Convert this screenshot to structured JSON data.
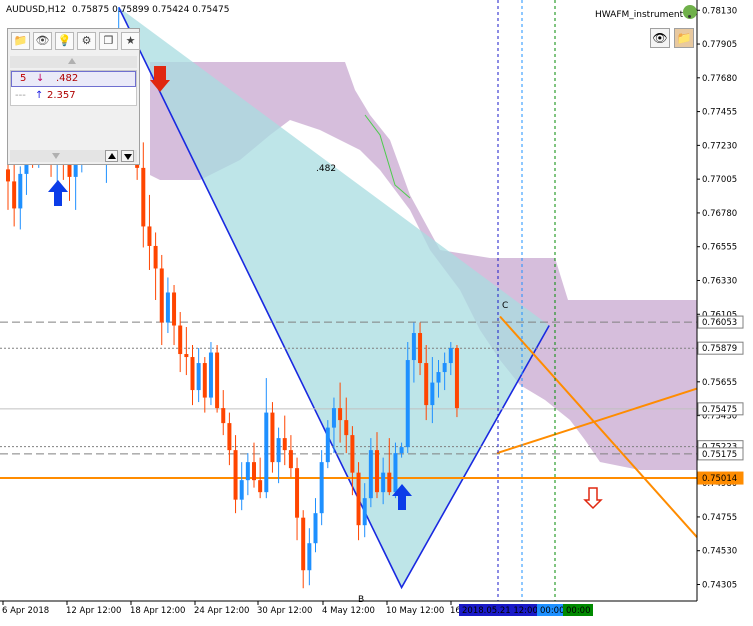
{
  "window": {
    "symbol_label": "AUDUSD,H12",
    "ohlc_label": "0.75875 0.75899 0.75424 0.75475"
  },
  "indicator": {
    "name": "HWAFM_instrument",
    "icon_name": "weather-icon"
  },
  "info_panel": {
    "toolbar_icons": [
      "folder-icon",
      "eye-icon",
      "bulb-icon",
      "gear-icon",
      "copy-icon",
      "star-icon"
    ],
    "zigzag_rows": [
      {
        "count": "5",
        "arrow": "↓",
        "value": ".482"
      },
      {
        "count": "---",
        "arrow": "↑",
        "value": "2.357"
      }
    ]
  },
  "price_axis": {
    "labels": [
      "0.78130",
      "0.77905",
      "0.77680",
      "0.77455",
      "0.77230",
      "0.77005",
      "0.76780",
      "0.76555",
      "0.76330",
      "0.76105",
      "0.75880",
      "0.75655",
      "0.75430",
      "0.75205",
      "0.74980",
      "0.74755",
      "0.74530",
      "0.74305"
    ],
    "highlights": [
      {
        "price": 0.76053,
        "text": "0.76053",
        "style": "gray"
      },
      {
        "price": 0.75879,
        "text": "0.75879",
        "style": "gray"
      },
      {
        "price": 0.75475,
        "text": "0.75475",
        "style": "gray"
      },
      {
        "price": 0.75223,
        "text": "0.75223",
        "style": "gray"
      },
      {
        "price": 0.75175,
        "text": "0.75175",
        "style": "gray"
      },
      {
        "price": 0.75014,
        "text": "0.75014",
        "style": "orange"
      }
    ]
  },
  "time_axis": {
    "labels": [
      "6 Apr 2018",
      "12 Apr 12:00",
      "18 Apr 12:00",
      "24 Apr 12:00",
      "30 Apr 12:00",
      "4 May 12:00",
      "10 May 12:00",
      "16"
    ],
    "highlight_labels": [
      {
        "text": "2018.05.21 12:00",
        "color": "#1a1ac8"
      },
      {
        "text": "00:00",
        "color": "#1e90ff"
      },
      {
        "text": "00:00",
        "color": "#008a00"
      }
    ]
  },
  "annotations": {
    "pattern_label": ".482",
    "point_b": "B",
    "point_c": "C"
  },
  "colors": {
    "bull": "#1e90ff",
    "bear": "#ff4500",
    "cloud": "#c8a8d0",
    "pattern_fill": "#a8dce0",
    "pattern_line": "#1a2ae0",
    "orange_line": "#ff8c00",
    "arrow_blue": "#0b3ce8",
    "arrow_red": "#e02810"
  },
  "chart_data": {
    "type": "candlestick",
    "title": "AUDUSD,H12",
    "ylim": [
      0.74195,
      0.78185
    ],
    "candles": [
      [
        0.7707,
        0.7723,
        0.768,
        0.7699
      ],
      [
        0.7699,
        0.7716,
        0.7669,
        0.7681
      ],
      [
        0.7681,
        0.7709,
        0.7667,
        0.7704
      ],
      [
        0.7704,
        0.7739,
        0.769,
        0.7727
      ],
      [
        0.7727,
        0.7764,
        0.7708,
        0.7715
      ],
      [
        0.7715,
        0.7736,
        0.7708,
        0.773
      ],
      [
        0.773,
        0.7757,
        0.7722,
        0.7745
      ],
      [
        0.7745,
        0.777,
        0.7702,
        0.7713
      ],
      [
        0.7713,
        0.7738,
        0.7696,
        0.7722
      ],
      [
        0.7722,
        0.774,
        0.77,
        0.7712
      ],
      [
        0.7712,
        0.7748,
        0.7686,
        0.7702
      ],
      [
        0.7702,
        0.773,
        0.768,
        0.7719
      ],
      [
        0.7719,
        0.7745,
        0.7705,
        0.7736
      ],
      [
        0.7736,
        0.776,
        0.772,
        0.7748
      ],
      [
        0.7748,
        0.7765,
        0.7729,
        0.7742
      ],
      [
        0.7742,
        0.775,
        0.771,
        0.7722
      ],
      [
        0.7722,
        0.776,
        0.7698,
        0.775
      ],
      [
        0.775,
        0.7778,
        0.773,
        0.7768
      ],
      [
        0.7768,
        0.7815,
        0.774,
        0.7775
      ],
      [
        0.7775,
        0.7782,
        0.773,
        0.7738
      ],
      [
        0.7738,
        0.7752,
        0.7715,
        0.7728
      ],
      [
        0.7728,
        0.7745,
        0.77,
        0.7708
      ],
      [
        0.7708,
        0.7725,
        0.7655,
        0.7669
      ],
      [
        0.7669,
        0.769,
        0.764,
        0.7656
      ],
      [
        0.7656,
        0.7665,
        0.762,
        0.7641
      ],
      [
        0.7641,
        0.765,
        0.759,
        0.7605
      ],
      [
        0.7605,
        0.7635,
        0.7598,
        0.7625
      ],
      [
        0.7625,
        0.763,
        0.759,
        0.7603
      ],
      [
        0.7603,
        0.7612,
        0.7572,
        0.7584
      ],
      [
        0.7584,
        0.7602,
        0.757,
        0.7582
      ],
      [
        0.7582,
        0.759,
        0.755,
        0.756
      ],
      [
        0.756,
        0.7588,
        0.7552,
        0.7578
      ],
      [
        0.7578,
        0.7582,
        0.7545,
        0.7555
      ],
      [
        0.7555,
        0.7592,
        0.755,
        0.7585
      ],
      [
        0.7585,
        0.759,
        0.7545,
        0.7548
      ],
      [
        0.7548,
        0.756,
        0.753,
        0.7538
      ],
      [
        0.7538,
        0.7545,
        0.751,
        0.752
      ],
      [
        0.752,
        0.753,
        0.7478,
        0.7487
      ],
      [
        0.7487,
        0.7512,
        0.748,
        0.75
      ],
      [
        0.75,
        0.7518,
        0.749,
        0.7512
      ],
      [
        0.7512,
        0.7525,
        0.7495,
        0.75
      ],
      [
        0.75,
        0.7515,
        0.7488,
        0.7492
      ],
      [
        0.7492,
        0.7568,
        0.7488,
        0.7545
      ],
      [
        0.7545,
        0.7552,
        0.7505,
        0.7512
      ],
      [
        0.7512,
        0.7535,
        0.7498,
        0.7528
      ],
      [
        0.7528,
        0.7543,
        0.751,
        0.752
      ],
      [
        0.752,
        0.753,
        0.7502,
        0.7508
      ],
      [
        0.7508,
        0.7515,
        0.746,
        0.7475
      ],
      [
        0.7475,
        0.748,
        0.7428,
        0.744
      ],
      [
        0.744,
        0.7468,
        0.743,
        0.7458
      ],
      [
        0.7458,
        0.7488,
        0.7452,
        0.7478
      ],
      [
        0.7478,
        0.752,
        0.747,
        0.7512
      ],
      [
        0.7512,
        0.754,
        0.7508,
        0.7535
      ],
      [
        0.7535,
        0.7555,
        0.7518,
        0.7548
      ],
      [
        0.7548,
        0.7565,
        0.7525,
        0.754
      ],
      [
        0.754,
        0.7555,
        0.7518,
        0.753
      ],
      [
        0.753,
        0.7536,
        0.749,
        0.7505
      ],
      [
        0.7505,
        0.7512,
        0.746,
        0.747
      ],
      [
        0.747,
        0.7498,
        0.7462,
        0.7488
      ],
      [
        0.7488,
        0.7528,
        0.7482,
        0.752
      ],
      [
        0.752,
        0.7532,
        0.7488,
        0.7492
      ],
      [
        0.7492,
        0.7515,
        0.7484,
        0.7505
      ],
      [
        0.7505,
        0.7528,
        0.749,
        0.7492
      ],
      [
        0.7492,
        0.7525,
        0.7488,
        0.7518
      ],
      [
        0.7518,
        0.7525,
        0.7515,
        0.7522
      ],
      [
        0.7522,
        0.7592,
        0.7518,
        0.758
      ],
      [
        0.758,
        0.7605,
        0.7565,
        0.7598
      ],
      [
        0.7598,
        0.7605,
        0.757,
        0.7578
      ],
      [
        0.7578,
        0.759,
        0.754,
        0.755
      ],
      [
        0.755,
        0.7582,
        0.7538,
        0.7565
      ],
      [
        0.7565,
        0.758,
        0.7555,
        0.7572
      ],
      [
        0.7572,
        0.7585,
        0.756,
        0.7578
      ],
      [
        0.7578,
        0.7592,
        0.757,
        0.7588
      ],
      [
        0.7588,
        0.759,
        0.7542,
        0.7548
      ]
    ],
    "xyab_pattern": {
      "X": [
        18,
        0.7815
      ],
      "A": [
        64,
        0.74285
      ],
      "B": [
        88,
        0.7603
      ]
    }
  }
}
